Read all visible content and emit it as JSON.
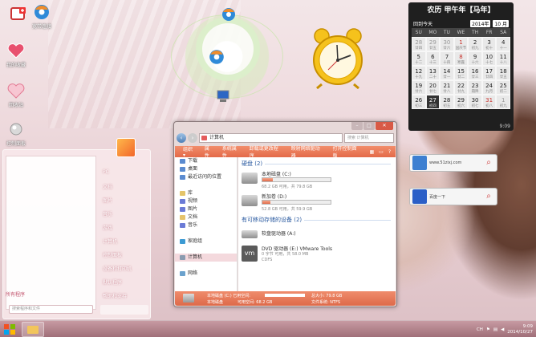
{
  "desktop": {
    "icons": [
      {
        "label": ""
      },
      {
        "label": "宽带连接"
      },
      {
        "label": "我的收藏"
      },
      {
        "label": "回收站"
      },
      {
        "label": "控制面板"
      }
    ]
  },
  "calendar": {
    "title": "农历 甲午年【马年】",
    "back_today": "回到今天",
    "year": "2014年",
    "month": "10 月",
    "weekdays": [
      "SU",
      "MO",
      "TU",
      "WE",
      "TH",
      "FR",
      "SA"
    ],
    "weeks": [
      [
        {
          "d": "28",
          "l": "廿四",
          "c": "dim"
        },
        {
          "d": "29",
          "l": "廿五",
          "c": "dim"
        },
        {
          "d": "30",
          "l": "廿六",
          "c": "dim"
        },
        {
          "d": "1",
          "l": "国庆节",
          "c": "wk"
        },
        {
          "d": "2",
          "l": "初九",
          "c": ""
        },
        {
          "d": "3",
          "l": "初十",
          "c": ""
        },
        {
          "d": "4",
          "l": "十一",
          "c": ""
        }
      ],
      [
        {
          "d": "5",
          "l": "十二",
          "c": ""
        },
        {
          "d": "6",
          "l": "十三",
          "c": ""
        },
        {
          "d": "7",
          "l": "十四",
          "c": ""
        },
        {
          "d": "8",
          "l": "寒露",
          "c": "wk"
        },
        {
          "d": "9",
          "l": "十六",
          "c": ""
        },
        {
          "d": "10",
          "l": "十七",
          "c": ""
        },
        {
          "d": "11",
          "l": "十八",
          "c": ""
        }
      ],
      [
        {
          "d": "12",
          "l": "十九",
          "c": ""
        },
        {
          "d": "13",
          "l": "二十",
          "c": ""
        },
        {
          "d": "14",
          "l": "廿一",
          "c": ""
        },
        {
          "d": "15",
          "l": "廿二",
          "c": ""
        },
        {
          "d": "16",
          "l": "廿三",
          "c": ""
        },
        {
          "d": "17",
          "l": "廿四",
          "c": ""
        },
        {
          "d": "18",
          "l": "廿五",
          "c": ""
        }
      ],
      [
        {
          "d": "19",
          "l": "廿六",
          "c": ""
        },
        {
          "d": "20",
          "l": "廿七",
          "c": ""
        },
        {
          "d": "21",
          "l": "廿八",
          "c": ""
        },
        {
          "d": "22",
          "l": "廿九",
          "c": ""
        },
        {
          "d": "23",
          "l": "霜降",
          "c": ""
        },
        {
          "d": "24",
          "l": "九月",
          "c": ""
        },
        {
          "d": "25",
          "l": "初二",
          "c": ""
        }
      ],
      [
        {
          "d": "26",
          "l": "初三",
          "c": ""
        },
        {
          "d": "27",
          "l": "初四",
          "c": "today"
        },
        {
          "d": "28",
          "l": "初五",
          "c": ""
        },
        {
          "d": "29",
          "l": "初六",
          "c": ""
        },
        {
          "d": "30",
          "l": "初七",
          "c": ""
        },
        {
          "d": "31",
          "l": "初八",
          "c": "wk"
        },
        {
          "d": "1",
          "l": "初九",
          "c": "dim"
        }
      ]
    ],
    "time": "9:09"
  },
  "search_gadgets": {
    "web_text": "www.51zixj.com",
    "baidu_text": "百度一下"
  },
  "start_menu": {
    "right_items": [
      "PC",
      "文档",
      "图片",
      "音乐",
      "游戏",
      "计算机",
      "控制面板",
      "设备和打印机",
      "默认程序",
      "帮助和支持"
    ],
    "all_programs": "所有程序",
    "search_placeholder": "搜索程序和文件"
  },
  "explorer": {
    "address": "计算机",
    "search_placeholder": "搜索 计算机",
    "toolbar": [
      "组织 ▾",
      "属性",
      "系统属性",
      "卸载或更改程序",
      "映射网络驱动器",
      "打开控制面板"
    ],
    "nav": [
      {
        "label": "下载",
        "c": "#5b8bd0"
      },
      {
        "label": "桌面",
        "c": "#5b8bd0"
      },
      {
        "label": "最近访问的位置",
        "c": "#5b8bd0"
      },
      {
        "label": "",
        "c": ""
      },
      {
        "label": "库",
        "c": "#e4c46a"
      },
      {
        "label": "视频",
        "c": "#6b7bd6"
      },
      {
        "label": "图片",
        "c": "#6b7bd6"
      },
      {
        "label": "文档",
        "c": "#e6c36b"
      },
      {
        "label": "音乐",
        "c": "#6b7bd6"
      },
      {
        "label": "",
        "c": ""
      },
      {
        "label": "家庭组",
        "c": "#3c9ad3"
      },
      {
        "label": "",
        "c": ""
      },
      {
        "label": "计算机",
        "c": "#8a9bb0"
      },
      {
        "label": "",
        "c": ""
      },
      {
        "label": "网络",
        "c": "#6ba2cd"
      }
    ],
    "nav_selected_index": 12,
    "section_hdd": "硬盘 (2)",
    "drives": [
      {
        "name": "本地磁盘 (C:)",
        "free": "68.2 GB 可用，共 79.8 GB",
        "used_fraction": 0.15
      },
      {
        "name": "新加卷 (D:)",
        "free": "52.8 GB 可用，共 59.9 GB",
        "used_fraction": 0.12
      }
    ],
    "section_removable": "有可移动存储的设备 (2)",
    "floppy": "软盘驱动器 (A:)",
    "dvd": {
      "name": "DVD 驱动器 (E:) VMware Tools",
      "free": "0 字节 可用，共 58.0 MB",
      "fs": "CDFS"
    },
    "details": {
      "name": "本地磁盘 (C:) 已用空间:",
      "type": "本地磁盘",
      "free_label": "可用空间: 68.2 GB",
      "total": "总大小: 79.8 GB",
      "fs": "文件系统: NTFS"
    }
  },
  "taskbar": {
    "lang": "CH",
    "time": "9:09",
    "date": "2014/10/27"
  }
}
